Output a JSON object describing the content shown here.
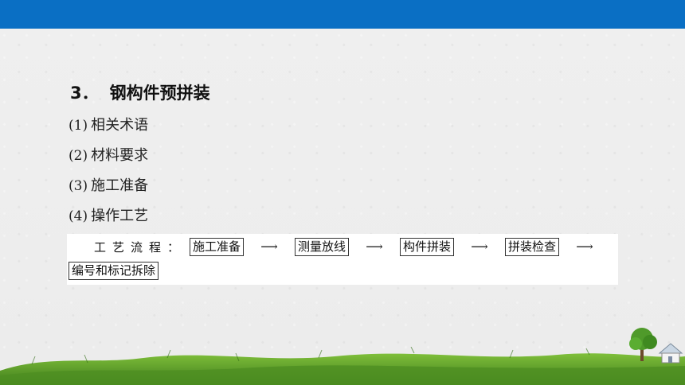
{
  "heading": {
    "number": "3．",
    "text": "钢构件预拼装"
  },
  "items": [
    {
      "marker": "(1)",
      "text": "相关术语"
    },
    {
      "marker": "(2)",
      "text": "材料要求"
    },
    {
      "marker": "(3)",
      "text": "施工准备"
    },
    {
      "marker": "(4)",
      "text": "操作工艺"
    }
  ],
  "flow": {
    "label": "工艺流程：",
    "steps": [
      "施工准备",
      "测量放线",
      "构件拼装",
      "拼装检查",
      "编号和标记拆除"
    ],
    "arrow": "⟶"
  },
  "colors": {
    "top_bar": "#0a6fc4",
    "grass": "#5a9e2a"
  }
}
